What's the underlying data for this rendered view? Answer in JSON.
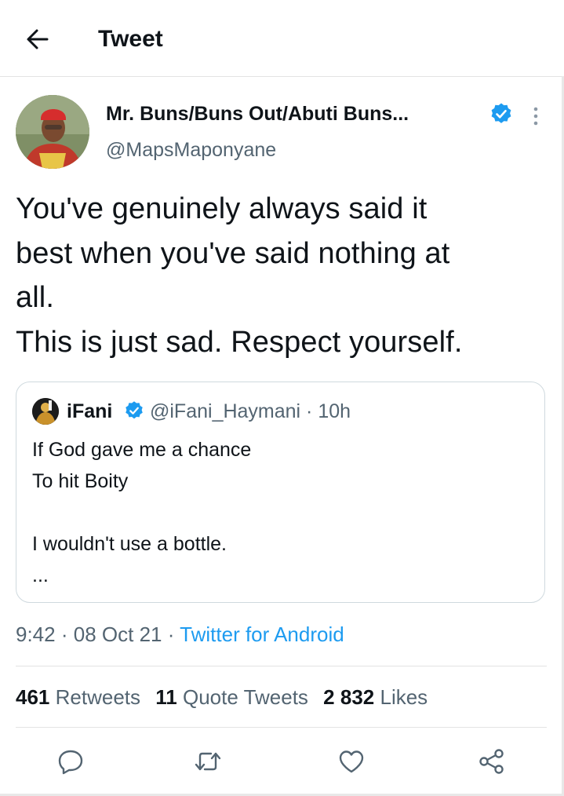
{
  "header": {
    "title": "Tweet",
    "back_icon": "arrow-left-icon"
  },
  "tweet": {
    "author_name": "Mr. Buns/Buns Out/Abuti Buns...",
    "handle": "@MapsMaponyane",
    "verified": true,
    "text": "You've genuinely always said it\nbest when you've said nothing at\nall.\nThis is just sad. Respect yourself.",
    "quoted": {
      "name": "iFani",
      "handle_time": "@iFani_Haymani · 10h",
      "verified": true,
      "text": "If God gave me a chance\nTo hit Boity\n\nI wouldn't use a bottle.\n..."
    },
    "time": "9:42",
    "date": "08 Oct 21",
    "separator": "·",
    "source": "Twitter for Android",
    "stats": {
      "retweets_count": "461",
      "retweets_label": "Retweets",
      "quotes_count": "11",
      "quotes_label": "Quote Tweets",
      "likes_count": "2 832",
      "likes_label": "Likes"
    }
  },
  "colors": {
    "accent": "#1d9bf0",
    "secondary_text": "#536471",
    "primary_text": "#0f1419",
    "border": "#cfd9de"
  },
  "actions": [
    "reply-icon",
    "retweet-icon",
    "like-icon",
    "share-icon"
  ]
}
